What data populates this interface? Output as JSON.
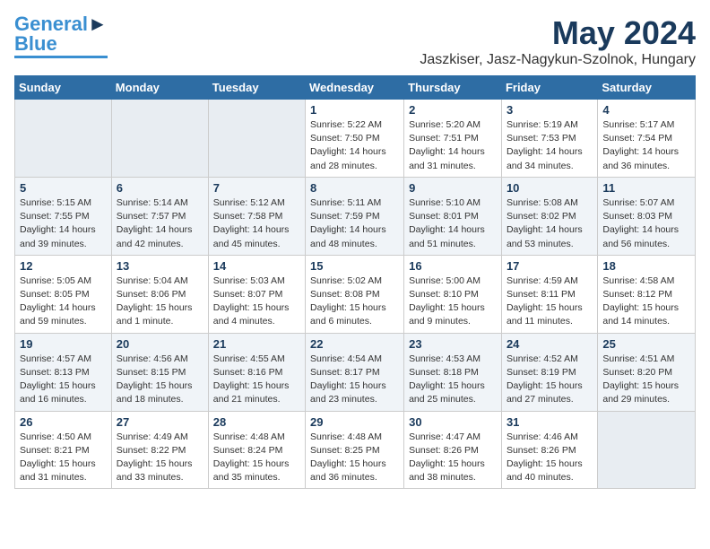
{
  "header": {
    "logo_general": "General",
    "logo_blue": "Blue",
    "month_year": "May 2024",
    "location": "Jaszkiser, Jasz-Nagykun-Szolnok, Hungary"
  },
  "days_of_week": [
    "Sunday",
    "Monday",
    "Tuesday",
    "Wednesday",
    "Thursday",
    "Friday",
    "Saturday"
  ],
  "weeks": [
    [
      {
        "day": "",
        "info": ""
      },
      {
        "day": "",
        "info": ""
      },
      {
        "day": "",
        "info": ""
      },
      {
        "day": "1",
        "info": "Sunrise: 5:22 AM\nSunset: 7:50 PM\nDaylight: 14 hours and 28 minutes."
      },
      {
        "day": "2",
        "info": "Sunrise: 5:20 AM\nSunset: 7:51 PM\nDaylight: 14 hours and 31 minutes."
      },
      {
        "day": "3",
        "info": "Sunrise: 5:19 AM\nSunset: 7:53 PM\nDaylight: 14 hours and 34 minutes."
      },
      {
        "day": "4",
        "info": "Sunrise: 5:17 AM\nSunset: 7:54 PM\nDaylight: 14 hours and 36 minutes."
      }
    ],
    [
      {
        "day": "5",
        "info": "Sunrise: 5:15 AM\nSunset: 7:55 PM\nDaylight: 14 hours and 39 minutes."
      },
      {
        "day": "6",
        "info": "Sunrise: 5:14 AM\nSunset: 7:57 PM\nDaylight: 14 hours and 42 minutes."
      },
      {
        "day": "7",
        "info": "Sunrise: 5:12 AM\nSunset: 7:58 PM\nDaylight: 14 hours and 45 minutes."
      },
      {
        "day": "8",
        "info": "Sunrise: 5:11 AM\nSunset: 7:59 PM\nDaylight: 14 hours and 48 minutes."
      },
      {
        "day": "9",
        "info": "Sunrise: 5:10 AM\nSunset: 8:01 PM\nDaylight: 14 hours and 51 minutes."
      },
      {
        "day": "10",
        "info": "Sunrise: 5:08 AM\nSunset: 8:02 PM\nDaylight: 14 hours and 53 minutes."
      },
      {
        "day": "11",
        "info": "Sunrise: 5:07 AM\nSunset: 8:03 PM\nDaylight: 14 hours and 56 minutes."
      }
    ],
    [
      {
        "day": "12",
        "info": "Sunrise: 5:05 AM\nSunset: 8:05 PM\nDaylight: 14 hours and 59 minutes."
      },
      {
        "day": "13",
        "info": "Sunrise: 5:04 AM\nSunset: 8:06 PM\nDaylight: 15 hours and 1 minute."
      },
      {
        "day": "14",
        "info": "Sunrise: 5:03 AM\nSunset: 8:07 PM\nDaylight: 15 hours and 4 minutes."
      },
      {
        "day": "15",
        "info": "Sunrise: 5:02 AM\nSunset: 8:08 PM\nDaylight: 15 hours and 6 minutes."
      },
      {
        "day": "16",
        "info": "Sunrise: 5:00 AM\nSunset: 8:10 PM\nDaylight: 15 hours and 9 minutes."
      },
      {
        "day": "17",
        "info": "Sunrise: 4:59 AM\nSunset: 8:11 PM\nDaylight: 15 hours and 11 minutes."
      },
      {
        "day": "18",
        "info": "Sunrise: 4:58 AM\nSunset: 8:12 PM\nDaylight: 15 hours and 14 minutes."
      }
    ],
    [
      {
        "day": "19",
        "info": "Sunrise: 4:57 AM\nSunset: 8:13 PM\nDaylight: 15 hours and 16 minutes."
      },
      {
        "day": "20",
        "info": "Sunrise: 4:56 AM\nSunset: 8:15 PM\nDaylight: 15 hours and 18 minutes."
      },
      {
        "day": "21",
        "info": "Sunrise: 4:55 AM\nSunset: 8:16 PM\nDaylight: 15 hours and 21 minutes."
      },
      {
        "day": "22",
        "info": "Sunrise: 4:54 AM\nSunset: 8:17 PM\nDaylight: 15 hours and 23 minutes."
      },
      {
        "day": "23",
        "info": "Sunrise: 4:53 AM\nSunset: 8:18 PM\nDaylight: 15 hours and 25 minutes."
      },
      {
        "day": "24",
        "info": "Sunrise: 4:52 AM\nSunset: 8:19 PM\nDaylight: 15 hours and 27 minutes."
      },
      {
        "day": "25",
        "info": "Sunrise: 4:51 AM\nSunset: 8:20 PM\nDaylight: 15 hours and 29 minutes."
      }
    ],
    [
      {
        "day": "26",
        "info": "Sunrise: 4:50 AM\nSunset: 8:21 PM\nDaylight: 15 hours and 31 minutes."
      },
      {
        "day": "27",
        "info": "Sunrise: 4:49 AM\nSunset: 8:22 PM\nDaylight: 15 hours and 33 minutes."
      },
      {
        "day": "28",
        "info": "Sunrise: 4:48 AM\nSunset: 8:24 PM\nDaylight: 15 hours and 35 minutes."
      },
      {
        "day": "29",
        "info": "Sunrise: 4:48 AM\nSunset: 8:25 PM\nDaylight: 15 hours and 36 minutes."
      },
      {
        "day": "30",
        "info": "Sunrise: 4:47 AM\nSunset: 8:26 PM\nDaylight: 15 hours and 38 minutes."
      },
      {
        "day": "31",
        "info": "Sunrise: 4:46 AM\nSunset: 8:26 PM\nDaylight: 15 hours and 40 minutes."
      },
      {
        "day": "",
        "info": ""
      }
    ]
  ]
}
